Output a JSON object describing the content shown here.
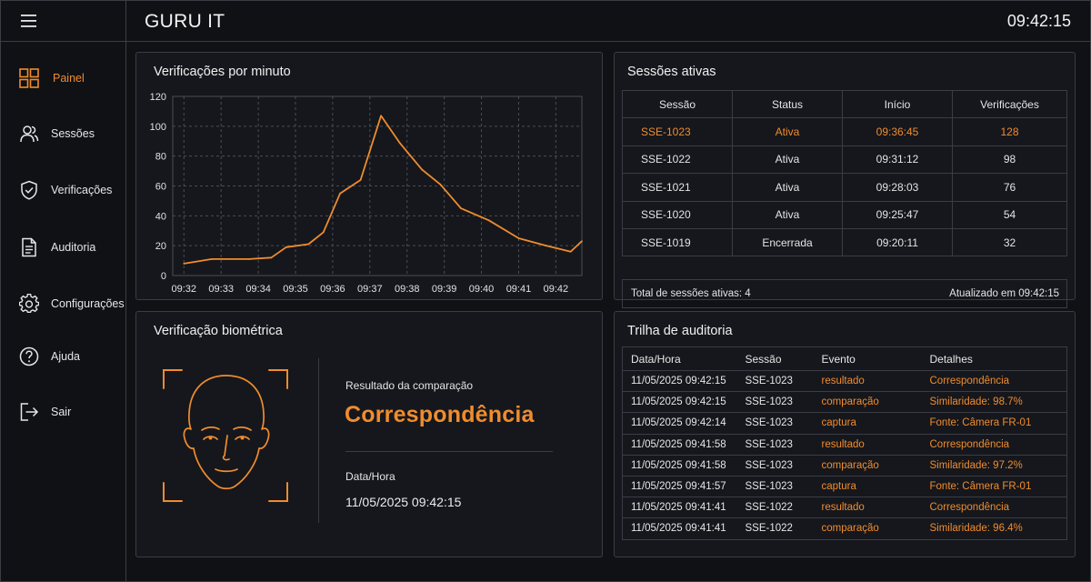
{
  "app": {
    "title": "GURU IT",
    "clock": "09:42:15"
  },
  "sidebar": {
    "items": [
      {
        "label": "Painel",
        "icon": "dashboard-icon",
        "active": true
      },
      {
        "label": "Sessões",
        "icon": "users-icon",
        "active": false
      },
      {
        "label": "Verificações",
        "icon": "shield-check-icon",
        "active": false
      },
      {
        "label": "Auditoria",
        "icon": "document-icon",
        "active": false
      },
      {
        "label": "Configurações",
        "icon": "gear-icon",
        "active": false
      },
      {
        "label": "Ajuda",
        "icon": "help-icon",
        "active": false
      },
      {
        "label": "Sair",
        "icon": "logout-icon",
        "active": false
      }
    ]
  },
  "chart_panel": {
    "title": "Verificações por minuto"
  },
  "chart_data": {
    "type": "line",
    "title": "Verificações por minuto",
    "xlabel": "",
    "ylabel": "",
    "x_ticks": [
      "09:32",
      "09:33",
      "09:34",
      "09:35",
      "09:36",
      "09:37",
      "09:38",
      "09:39",
      "09:40",
      "09:41",
      "09:42"
    ],
    "y_ticks": [
      0,
      20,
      40,
      60,
      80,
      100,
      120
    ],
    "ylim": [
      0,
      120
    ],
    "xlim_minutes": [
      -0.3,
      10.7
    ],
    "grid": true,
    "color": "#f08c2e",
    "series": [
      {
        "x": [
          0,
          0.75,
          1.75,
          2.35,
          2.75,
          3.35,
          3.75,
          4.2,
          4.75,
          5.3,
          5.8,
          6.4,
          6.9,
          7.45,
          8.2,
          9.0,
          9.75,
          10.4,
          10.7
        ],
        "y": [
          8,
          11,
          11,
          12,
          19,
          21,
          29,
          55,
          64,
          107,
          89,
          71,
          61,
          45,
          37,
          25,
          20,
          16,
          23
        ]
      }
    ]
  },
  "sessions": {
    "title": "Sessões ativas",
    "columns": [
      "Sessão",
      "Status",
      "Início",
      "Verificações"
    ],
    "rows": [
      [
        "SSE-1023",
        "Ativa",
        "09:36:45",
        "128"
      ],
      [
        "SSE-1022",
        "Ativa",
        "09:31:12",
        "98"
      ],
      [
        "SSE-1021",
        "Ativa",
        "09:28:03",
        "76"
      ],
      [
        "SSE-1020",
        "Ativa",
        "09:25:47",
        "54"
      ],
      [
        "SSE-1019",
        "Encerrada",
        "09:20:11",
        "32"
      ]
    ],
    "footer_total": "Total de sessões ativas: 4",
    "footer_updated": "Atualizado em 09:42:15"
  },
  "biometric": {
    "title": "Verificação biométrica",
    "result_label": "Resultado da comparação",
    "result": "Correspondência",
    "datetime_label": "Data/Hora",
    "datetime": "11/05/2025 09:42:15"
  },
  "audit": {
    "title": "Trilha de auditoria",
    "columns": [
      "Data/Hora",
      "Sessão",
      "Evento",
      "Detalhes"
    ],
    "rows": [
      [
        "11/05/2025 09:42:15",
        "SSE-1023",
        "resultado",
        "Correspondência"
      ],
      [
        "11/05/2025 09:42:15",
        "SSE-1023",
        "comparação",
        "Similaridade: 98.7%"
      ],
      [
        "11/05/2025 09:42:14",
        "SSE-1023",
        "captura",
        "Fonte: Câmera FR-01"
      ],
      [
        "11/05/2025 09:41:58",
        "SSE-1023",
        "resultado",
        "Correspondência"
      ],
      [
        "11/05/2025 09:41:58",
        "SSE-1023",
        "comparação",
        "Similaridade: 97.2%"
      ],
      [
        "11/05/2025 09:41:57",
        "SSE-1023",
        "captura",
        "Fonte: Câmera FR-01"
      ],
      [
        "11/05/2025 09:41:41",
        "SSE-1022",
        "resultado",
        "Correspondência"
      ],
      [
        "11/05/2025 09:41:41",
        "SSE-1022",
        "comparação",
        "Similaridade: 96.4%"
      ]
    ]
  },
  "colors": {
    "accent": "#f08c2e",
    "background": "#0f1115",
    "panel": "#15171c",
    "border": "#3a3d44"
  }
}
